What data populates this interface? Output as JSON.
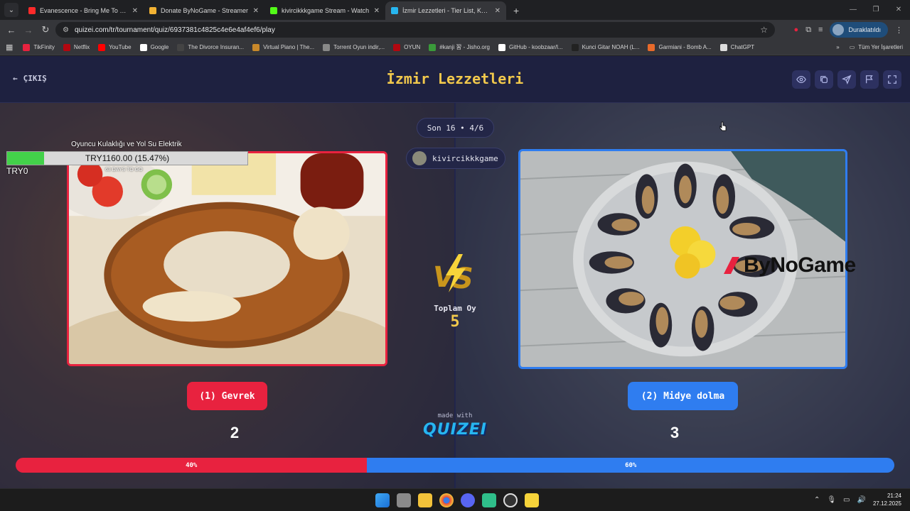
{
  "browser": {
    "tabs": [
      {
        "title": "Evanescence - Bring Me To Life",
        "favicon_color": "#ff2a2a",
        "active": false
      },
      {
        "title": "Donate ByNoGame - Streamer",
        "favicon_color": "#f2b233",
        "active": false
      },
      {
        "title": "kivircikkkgame Stream - Watch",
        "favicon_color": "#53fc18",
        "active": false
      },
      {
        "title": "İzmir Lezzetleri - Tier List, Kör S",
        "favicon_color": "#27b6f0",
        "active": true
      }
    ],
    "url": "quizei.com/tr/tournament/quiz/6937381c4825c4e6e4af4ef6/play",
    "profile_label": "Duraklatıldı",
    "bookmarks": [
      {
        "label": "TikFinity",
        "color": "#e8223f"
      },
      {
        "label": "Netflix",
        "color": "#b20710"
      },
      {
        "label": "YouTube",
        "color": "#ff0000"
      },
      {
        "label": "Google",
        "color": "#ffffff"
      },
      {
        "label": "The Divorce Insuran...",
        "color": "#444444"
      },
      {
        "label": "Virtual Piano | The...",
        "color": "#c8882a"
      },
      {
        "label": "Torrent Oyun indir,...",
        "color": "#888888"
      },
      {
        "label": "OYUN",
        "color": "#b20710"
      },
      {
        "label": "#kanji 習 - Jisho.org",
        "color": "#3a9a3a"
      },
      {
        "label": "GitHub - koobzaar/l...",
        "color": "#ffffff"
      },
      {
        "label": "Kunci Gitar NOAH (L...",
        "color": "#222222"
      },
      {
        "label": "Garmiani - Bomb A...",
        "color": "#e86a2a"
      },
      {
        "label": "ChatGPT",
        "color": "#dddddd"
      }
    ],
    "all_bookmarks_label": "Tüm Yer İşaretleri"
  },
  "quiz": {
    "exit_label": "ÇIKIŞ",
    "title": "İzmir Lezzetleri",
    "round": "Son 16 • 4/6",
    "streamer": "kivircikkkgame",
    "total_votes_label": "Toplam Oy",
    "total_votes": "5",
    "left_choice": {
      "label": "(1) Gevrek",
      "votes": "2",
      "percent_label": "40%",
      "percent": 40,
      "color": "#e8223f"
    },
    "right_choice": {
      "label": "(2) Midye dolma",
      "votes": "3",
      "percent_label": "60%",
      "percent": 60,
      "color": "#2f7df0"
    },
    "made_with": "made with",
    "brand": "QUIZEI"
  },
  "overlay": {
    "goal_title": "Oyuncu Kulaklığı ve Yol Su Elektrik",
    "goal_text": "TRY1160.00 (15.47%)",
    "goal_progress": 0.1547,
    "goal_start": "TRY0",
    "goal_days": "63 DAYS TO GO",
    "sponsor": "ByNoGame"
  },
  "taskbar": {
    "time": "21:24",
    "date": "27.12.2025"
  }
}
